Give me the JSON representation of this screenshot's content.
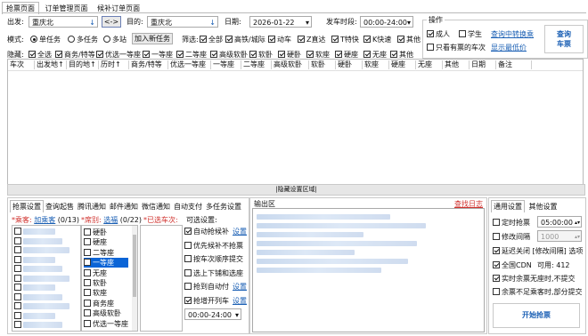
{
  "tabs": [
    "抢票页面",
    "订单管理页面",
    "候补订单页面"
  ],
  "search": {
    "from_label": "出发:",
    "from_value": "重庆北",
    "swap": "<->",
    "to_label": "目的:",
    "to_value": "重庆北",
    "date_label": "日期:",
    "date_value": "2026-01-22",
    "time_label": "发车时段:",
    "time_value": "00:00-24:00",
    "mode_label": "模式:",
    "modes": [
      "单任务",
      "多任务",
      "多站"
    ],
    "add_task": "加入新任务",
    "filter_label": "筛选:",
    "filters": [
      "全部",
      "高铁/城际",
      "动车",
      "Z直达",
      "T特快",
      "K快速",
      "其他"
    ],
    "hide_label": "隐藏:",
    "hide_items": [
      "全选",
      "商务/特等",
      "优选一等座",
      "一等座",
      "二等座",
      "高级软卧",
      "软卧",
      "硬卧",
      "软座",
      "硬座",
      "无座",
      "其他"
    ]
  },
  "ops": {
    "title": "操作",
    "adult": "成人",
    "student": "学生",
    "transfer_link": "查询中转换乘",
    "only_available": "只看有票的车次",
    "show_min_price": "显示最低价",
    "query_button": "查询\n车票"
  },
  "table": {
    "columns": [
      "车次",
      "出发地↑",
      "目的地↑",
      "历时↑",
      "商务/特等",
      "优选一等座",
      "一等座",
      "二等座",
      "高级软卧",
      "软卧",
      "硬卧",
      "软座",
      "硬座",
      "无座",
      "其他",
      "日期",
      "备注"
    ],
    "hide_bar": "|隐藏设置区域|"
  },
  "settings": {
    "tabs": [
      "抢票设置",
      "查询起售",
      "腾讯通知",
      "邮件通知",
      "微信通知",
      "自动支付",
      "多任务设置"
    ],
    "passenger_label": "*乘客:",
    "passenger_link": "加乘客",
    "passenger_count": "(0/13)",
    "seat_label": "*席别:",
    "seat_link": "选福",
    "seat_count": "(0/22)",
    "chosen_train_label": "*已选车次:",
    "seats": [
      "硬卧",
      "硬座",
      "二等座",
      "一等座",
      "无座",
      "软卧",
      "软座",
      "商务座",
      "高级软卧",
      "优选一等座"
    ],
    "selected_seat": "一等座",
    "options_label": "可选设置:",
    "options": [
      {
        "label": "自动抢候补",
        "link": "设置",
        "checked": true
      },
      {
        "label": "优先候补不抢票",
        "link": "",
        "checked": false
      },
      {
        "label": "按车次顺序提交",
        "link": "",
        "checked": false
      },
      {
        "label": "选上下铺和选座",
        "link": "",
        "checked": false
      },
      {
        "label": "抢到自动付",
        "link": "设置",
        "checked": false
      },
      {
        "label": "抢增开列车",
        "link": "设置",
        "checked": true
      }
    ],
    "time_select": "00:00-24:00"
  },
  "output": {
    "title": "输出区",
    "log_link": "查找日志"
  },
  "general": {
    "tabs": [
      "通用设置",
      "其他设置"
    ],
    "timed_label": "定时抢票",
    "timed_value": "05:00:00",
    "interval_label": "修改间隔",
    "interval_value": "1000",
    "delay_label": "延迟关闭 [修改间隔] 选项",
    "cdn_label": "全国CDN",
    "cdn_count": "可用: 412",
    "realtime_label": "实时余票无座时,不提交",
    "partial_label": "余票不足乘客时,部分提交",
    "start_button": "开始抢票"
  }
}
